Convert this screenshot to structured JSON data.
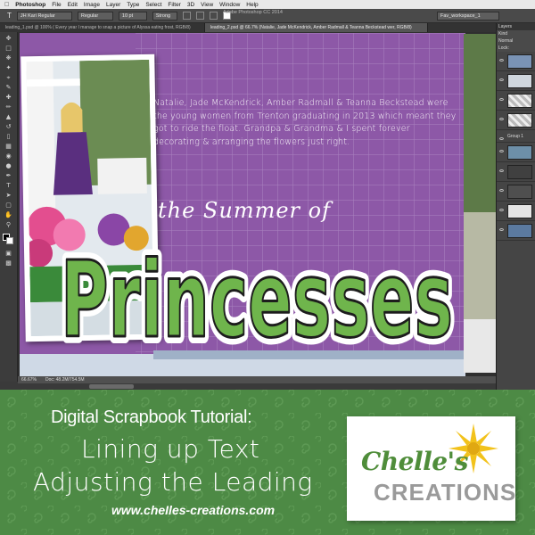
{
  "menubar": {
    "app_name": "Photoshop",
    "items": [
      "File",
      "Edit",
      "Image",
      "Layer",
      "Type",
      "Select",
      "Filter",
      "3D",
      "View",
      "Window",
      "Help"
    ]
  },
  "options_bar": {
    "font_family": "JH Kari Regular",
    "font_style": "Regular",
    "font_size": "10 pt",
    "antialias": "Strong",
    "app_title": "Adobe Photoshop CC 2014",
    "right_field": "Fav_workspace_1"
  },
  "tabs": [
    {
      "label": "leading_1.psd @ 100% ( Every year I manage to snap a picture of Alyssa eating frost, RGB/8)",
      "active": false
    },
    {
      "label": "leading_2.psd @ 66.7% (Natalie, Jade McKendrick, Amber Radmall & Teanna Beckstead wer, RGB/8)",
      "active": true
    }
  ],
  "document": {
    "journal_text": "Natalie, Jade McKendrick, Amber Radmall & Teanna Beckstead were the young women from Trenton graduating in 2013 which meant they got to ride the float. Grandpa & Grandma & I spent forever decorating & arranging the flowers just right.",
    "subtitle": "the Summer of",
    "title_word": "Princesses",
    "paper_color": "#8e5aa8",
    "title_fill": "#6fb54c"
  },
  "status_bar": {
    "zoom": "66.67%",
    "doc_size": "Doc: 48.2M/754.5M"
  },
  "panels": {
    "layers_label": "Layers",
    "kind_label": "Kind",
    "normal_label": "Normal",
    "lock_label": "Lock:",
    "group_label": "Group 1"
  },
  "banner": {
    "line1": "Digital Scrapbook Tutorial:",
    "line2": "Lining up Text",
    "line3": "Adjusting the Leading",
    "url": "www.cheIles-creations.com",
    "logo_top": "Chelle's",
    "logo_bottom": "CREATIONS",
    "background_color": "#4d8a45",
    "logo_green": "#4f8d3a",
    "logo_sun": "#f2c21b"
  }
}
